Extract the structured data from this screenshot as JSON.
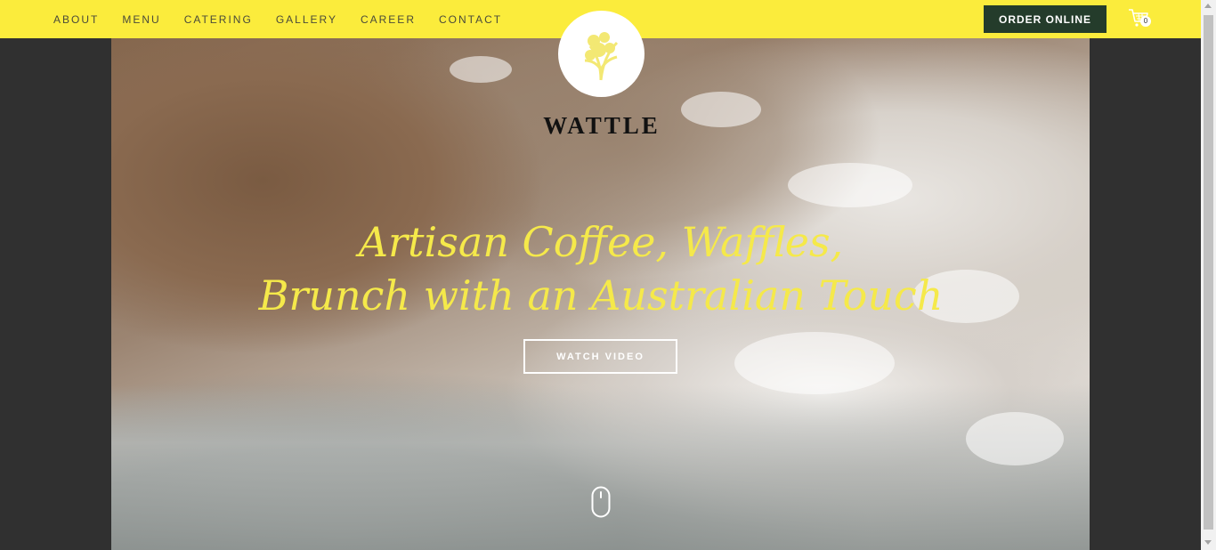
{
  "nav": {
    "items": [
      {
        "label": "ABOUT"
      },
      {
        "label": "MENU"
      },
      {
        "label": "CATERING"
      },
      {
        "label": "GALLERY"
      },
      {
        "label": "CAREER"
      },
      {
        "label": "CONTACT"
      }
    ],
    "order_label": "ORDER ONLINE",
    "cart_icon": "shopping-cart-icon",
    "cart_count": "0"
  },
  "brand": {
    "name": "WATTLE",
    "logo_icon": "wattle-flower-icon"
  },
  "hero": {
    "headline_line1": "Artisan Coffee, Waffles,",
    "headline_line2": "Brunch with an Australian Touch",
    "watch_label": "WATCH VIDEO",
    "scroll_icon": "mouse-scroll-icon"
  },
  "colors": {
    "topbar": "#fbec3c",
    "order_button": "#243c2b",
    "headline": "#f5e94a",
    "page_background": "#303030"
  }
}
